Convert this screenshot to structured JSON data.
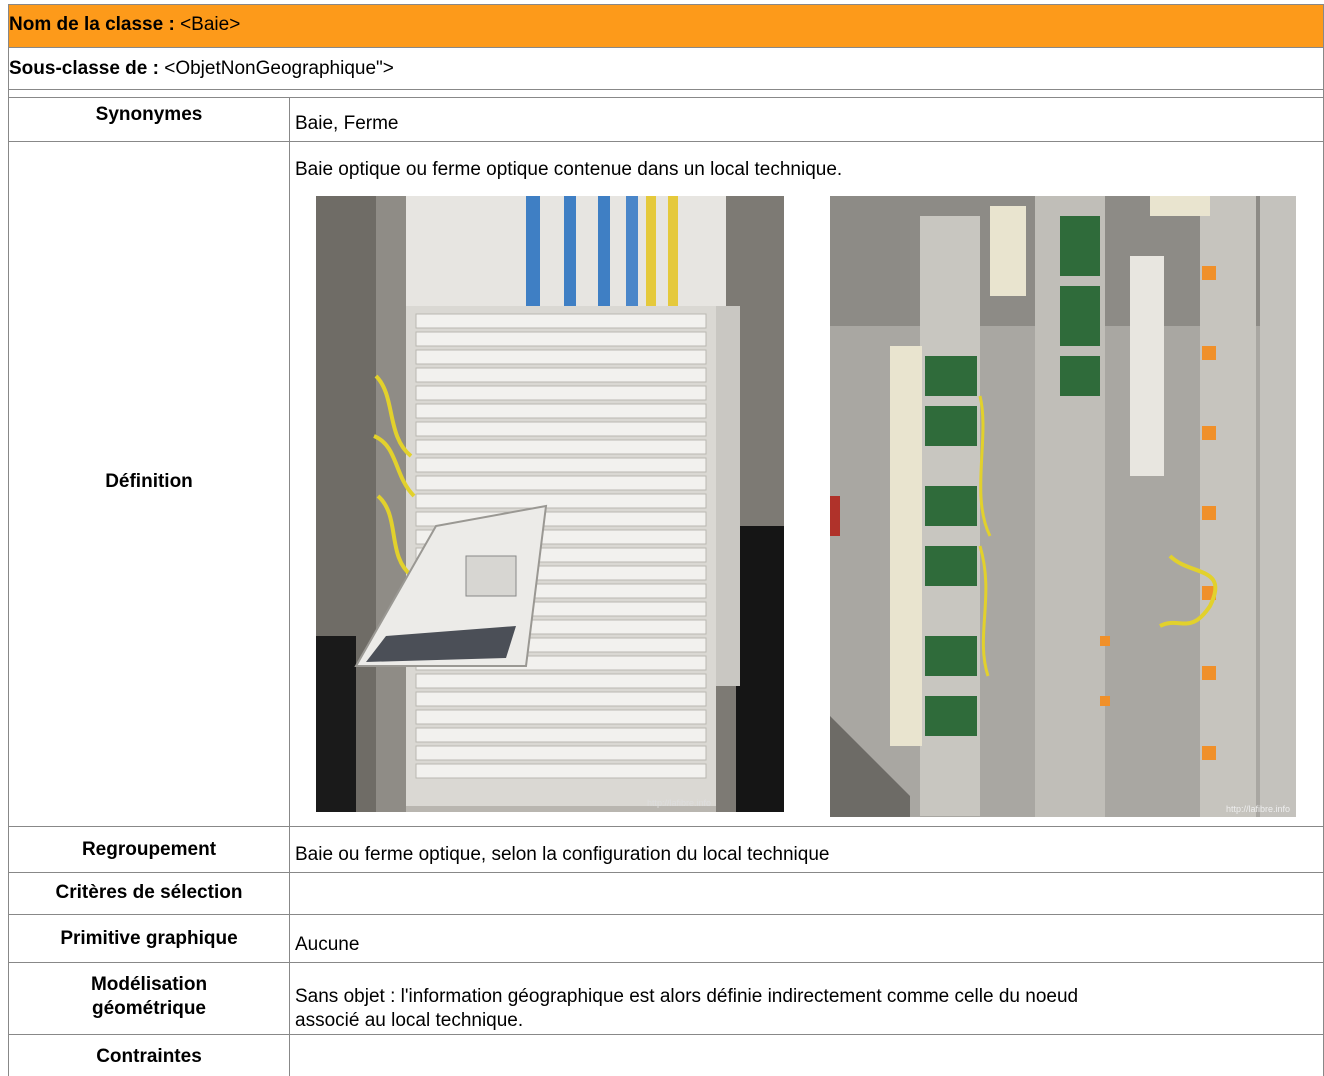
{
  "header": {
    "label": "Nom de la classe :",
    "value": "<Baie>",
    "color": "#fd9a1a"
  },
  "subclass": {
    "label": "Sous-classe de :",
    "value": "<ObjetNonGeographique\">"
  },
  "rows": {
    "synonymes": {
      "label": "Synonymes",
      "value": "Baie, Ferme"
    },
    "definition": {
      "label": "Définition",
      "value": "Baie optique ou ferme optique contenue dans un local technique."
    },
    "regroupement": {
      "label": "Regroupement",
      "value": "Baie ou ferme optique, selon la configuration du local technique"
    },
    "criteres": {
      "label": "Critères de sélection",
      "value": ""
    },
    "primitive": {
      "label": "Primitive graphique",
      "value": "Aucune"
    },
    "modelisation": {
      "label_line1": "Modélisation",
      "label_line2": "géométrique",
      "value_line1": "Sans objet : l'information géographique est alors définie indirectement comme celle du noeud",
      "value_line2": "associé au local technique."
    },
    "contraintes": {
      "label": "Contraintes",
      "value": ""
    }
  },
  "images": {
    "photo1": {
      "watermark": "http://lafibre.info"
    },
    "photo2": {
      "watermark": "http://lafibre.info"
    }
  }
}
